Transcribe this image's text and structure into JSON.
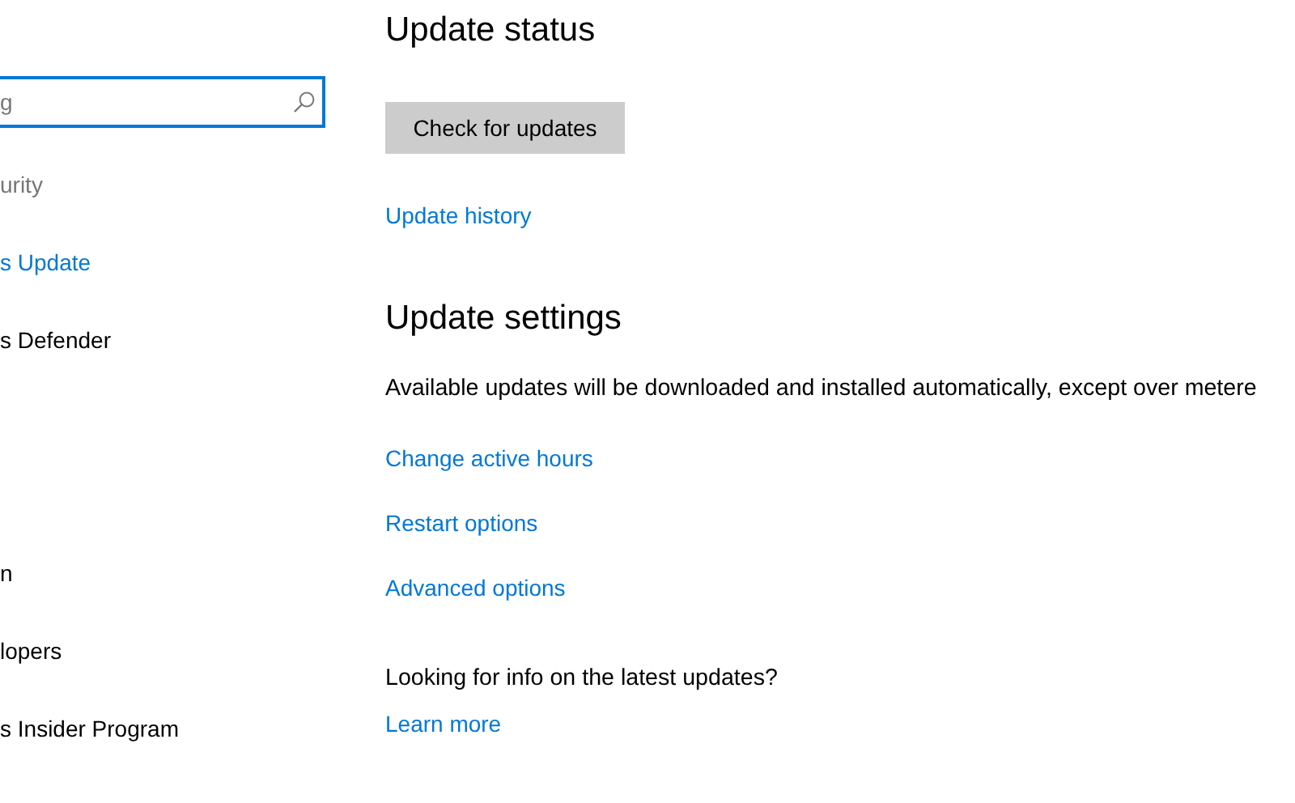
{
  "search": {
    "placeholder": "g"
  },
  "sidebar": {
    "items": [
      {
        "label": "urity",
        "kind": "heading"
      },
      {
        "label": "s Update",
        "kind": "item",
        "selected": true
      },
      {
        "label": "s Defender",
        "kind": "item",
        "selected": false
      },
      {
        "label": "n",
        "kind": "item",
        "selected": false
      },
      {
        "label": "lopers",
        "kind": "item",
        "selected": false
      },
      {
        "label": "s Insider Program",
        "kind": "item",
        "selected": false
      }
    ]
  },
  "update_status": {
    "title": "Update status",
    "button": "Check for updates",
    "link": "Update history"
  },
  "update_settings": {
    "title": "Update settings",
    "description": "Available updates will be downloaded and installed automatically, except over metere",
    "links": [
      "Change active hours",
      "Restart options",
      "Advanced options"
    ]
  },
  "info": {
    "question": "Looking for info on the latest updates?",
    "link": "Learn more"
  }
}
